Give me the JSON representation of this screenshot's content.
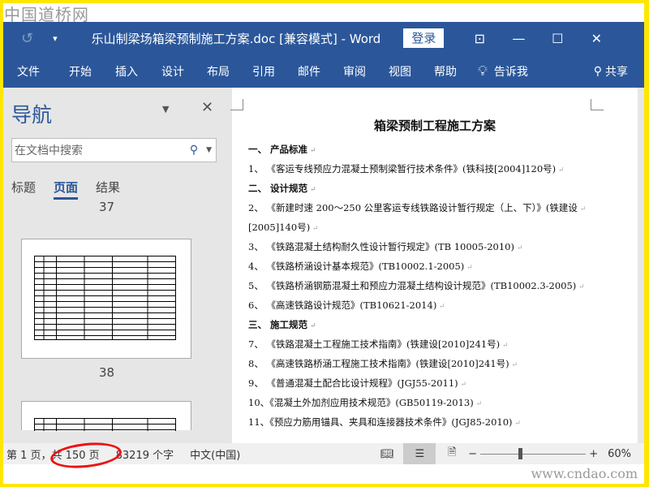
{
  "watermark_top": "中国道桥网",
  "watermark_bottom": "www.cndao.com",
  "titlebar": {
    "title": "乐山制梁场箱梁预制施工方案.doc [兼容模式]  -  Word",
    "login": "登录"
  },
  "ribbon": [
    "文件",
    "开始",
    "插入",
    "设计",
    "布局",
    "引用",
    "邮件",
    "审阅",
    "视图",
    "帮助"
  ],
  "tell_me": "告诉我",
  "share": "共享",
  "nav": {
    "title": "导航",
    "search_placeholder": "在文档中搜索",
    "tabs": [
      "标题",
      "页面",
      "结果"
    ],
    "page_labels": [
      "37",
      "38"
    ]
  },
  "doc": {
    "title": "箱梁预制工程施工方案",
    "lines": [
      {
        "t": "一、   产品标准",
        "sec": true
      },
      {
        "t": "1、 《客运专线预应力混凝土预制梁暂行技术条件》(铁科技[2004]120号)"
      },
      {
        "t": "二、   设计规范",
        "sec": true
      },
      {
        "t": "2、 《新建时速 200～250 公里客运专线铁路设计暂行规定（上、下）》(铁建设"
      },
      {
        "t": "[2005]140号)"
      },
      {
        "t": "3、 《铁路混凝土结构耐久性设计暂行规定》(TB 10005-2010)"
      },
      {
        "t": "4、 《铁路桥涵设计基本规范》(TB10002.1-2005)"
      },
      {
        "t": "5、 《铁路桥涵钢筋混凝土和预应力混凝土结构设计规范》(TB10002.3-2005)"
      },
      {
        "t": "6、 《高速铁路设计规范》(TB10621-2014)"
      },
      {
        "t": "三、   施工规范",
        "sec": true
      },
      {
        "t": "7、 《铁路混凝土工程施工技术指南》(铁建设[2010]241号)"
      },
      {
        "t": "8、 《高速铁路桥涵工程施工技术指南》(铁建设[2010]241号)"
      },
      {
        "t": "9、 《普通混凝土配合比设计规程》(JGJ55-2011)"
      },
      {
        "t": "10、《混凝土外加剂应用技术规范》(GB50119-2013)"
      },
      {
        "t": "11、《预应力筋用锚具、夹具和连接器技术条件》(JGJ85-2010)"
      }
    ]
  },
  "status": {
    "page": "第 1 页，共 150 页",
    "words": "83219 个字",
    "lang": "中文(中国)",
    "zoom": "60%",
    "zoom_level": 60
  }
}
